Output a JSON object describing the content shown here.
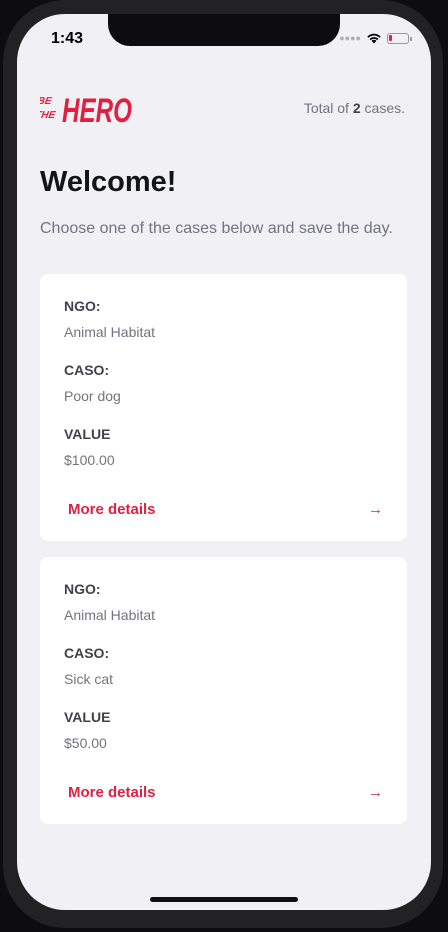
{
  "status": {
    "time": "1:43"
  },
  "header": {
    "logo_alt": "Be The Hero",
    "total_prefix": "Total of",
    "total_count": "2",
    "total_suffix": "cases."
  },
  "welcome": {
    "title": "Welcome!",
    "subtitle": "Choose one of the cases below and save the day."
  },
  "labels": {
    "ngo": "NGO:",
    "caso": "CASO:",
    "value": "VALUE",
    "details": "More details"
  },
  "cases": [
    {
      "ngo": "Animal Habitat",
      "caso": "Poor dog",
      "value": "$100.00"
    },
    {
      "ngo": "Animal Habitat",
      "caso": "Sick cat",
      "value": "$50.00"
    }
  ],
  "colors": {
    "accent": "#e02041",
    "background": "#f0f0f5",
    "text_dark": "#13131a",
    "text_muted": "#737380"
  }
}
